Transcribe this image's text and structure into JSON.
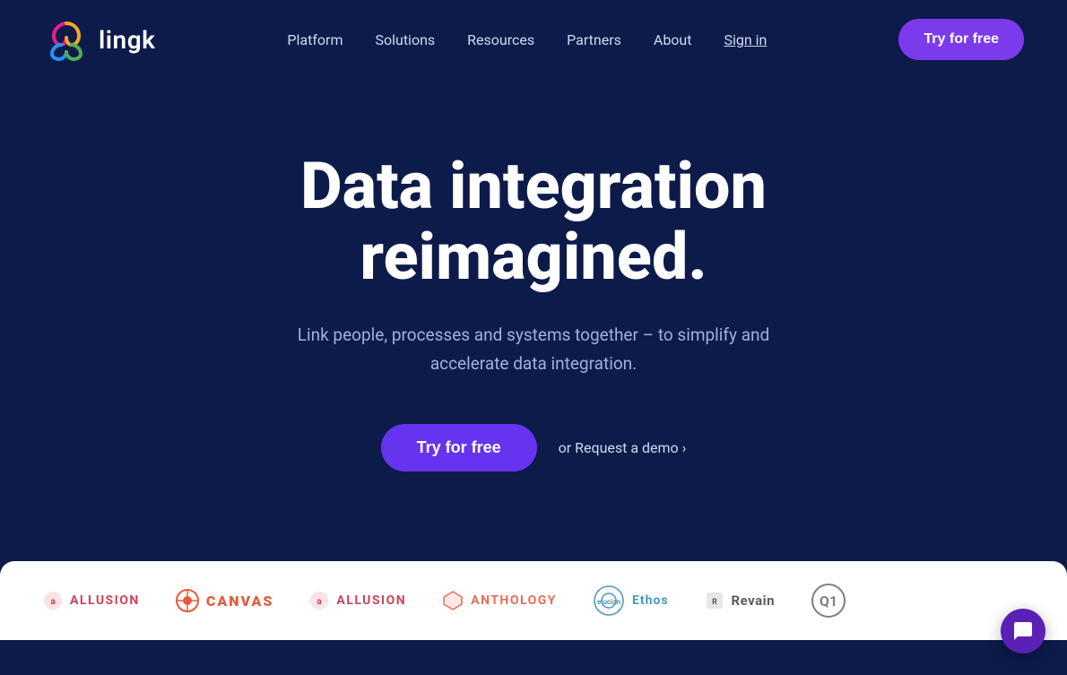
{
  "colors": {
    "bg": "#0d1b4b",
    "navCta": "#7c3aed",
    "heroCta": "#6633ee",
    "logosBg": "#ffffff",
    "chatWidget": "#5b21b6"
  },
  "logo": {
    "text": "lingk"
  },
  "nav": {
    "links": [
      {
        "label": "Platform",
        "href": "#",
        "underline": false
      },
      {
        "label": "Solutions",
        "href": "#",
        "underline": false
      },
      {
        "label": "Resources",
        "href": "#",
        "underline": false
      },
      {
        "label": "Partners",
        "href": "#",
        "underline": false
      },
      {
        "label": "About",
        "href": "#",
        "underline": false
      },
      {
        "label": "Sign in",
        "href": "#",
        "underline": true
      }
    ],
    "cta_label": "Try for free"
  },
  "hero": {
    "title_line1": "Data integration",
    "title_line2": "reimagined.",
    "subtitle": "Link people, processes and systems together – to simplify and accelerate data integration.",
    "cta_label": "Try for free",
    "demo_text": "or Request a demo ›"
  },
  "brands": [
    {
      "name": "allusion",
      "color": "#c41230",
      "icon_color": "#c41230"
    },
    {
      "name": "CANVAS",
      "color": "#e13f1a",
      "icon_color": "#e13f1a"
    },
    {
      "name": "allusion",
      "color": "#c41230",
      "icon_color": "#c41230"
    },
    {
      "name": "anthology",
      "color": "#e8472f",
      "icon_color": "#e8472f"
    },
    {
      "name": "Ethos",
      "color": "#1a7caa",
      "icon_color": "#1a7caa"
    },
    {
      "name": "Revain",
      "color": "#333333",
      "icon_color": "#555"
    }
  ]
}
